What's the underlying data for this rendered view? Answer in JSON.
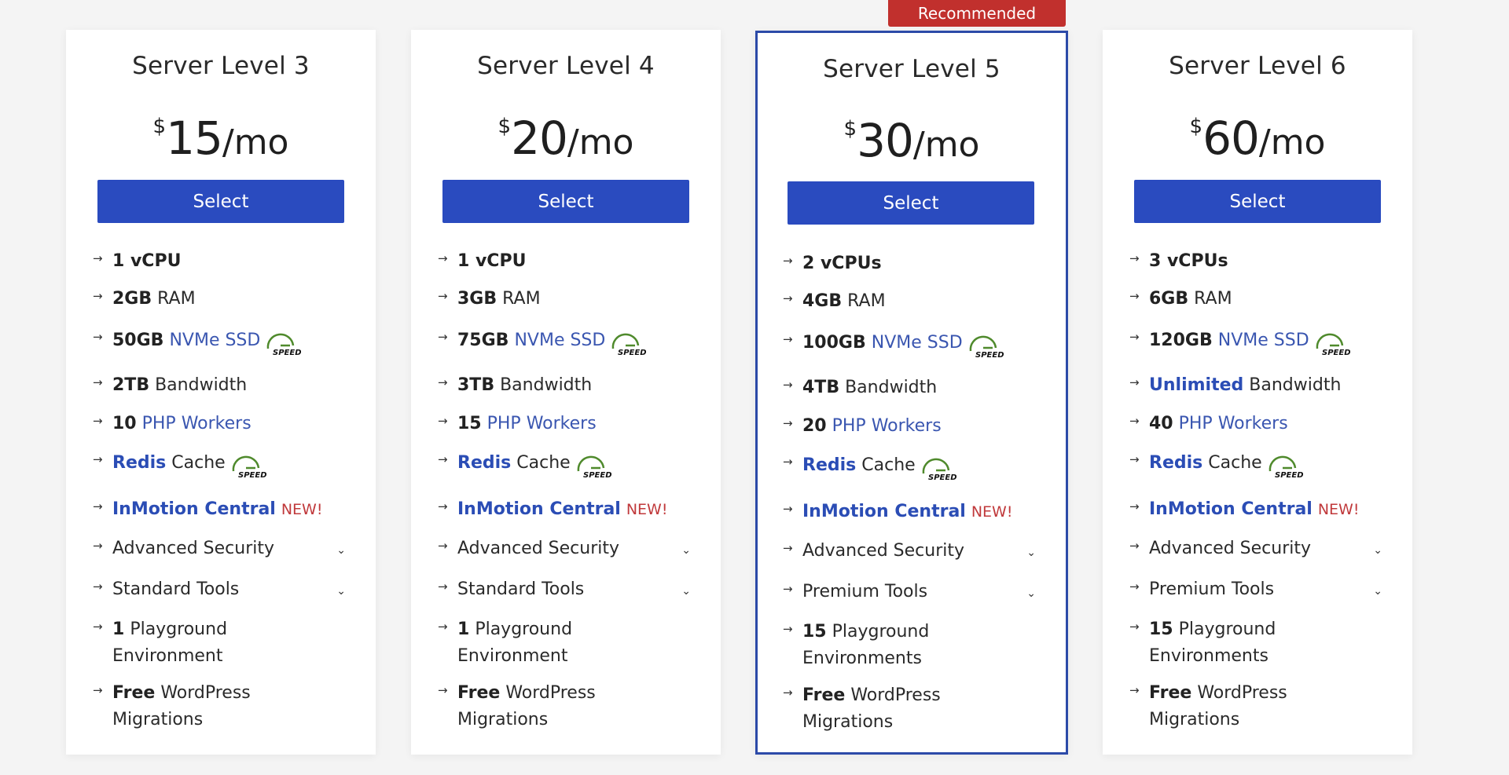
{
  "badge": "Recommended",
  "icons": {
    "arrow": "→",
    "chevron": "⌄",
    "speed_label": "SPEED"
  },
  "colors": {
    "accent_blue": "#2a4bbf",
    "badge_red": "#c1302d",
    "new_red": "#c0393b",
    "speed_green": "#4f8a2c"
  },
  "plans": [
    {
      "title": "Server Level 3",
      "price": {
        "currency": "$",
        "amount": "15",
        "period": "/mo"
      },
      "select_label": "Select",
      "features": {
        "cpu": {
          "value": "1 vCPU"
        },
        "ram": {
          "value": "2GB",
          "label": "RAM"
        },
        "ssd": {
          "value": "50GB",
          "label": "NVMe SSD"
        },
        "bandwidth": {
          "value": "2TB",
          "label": "Bandwidth"
        },
        "php": {
          "value": "10",
          "label": "PHP Workers"
        },
        "redis": {
          "value": "Redis",
          "label": "Cache"
        },
        "central": {
          "value": "InMotion Central",
          "label": "NEW!"
        },
        "security": {
          "label": "Advanced Security"
        },
        "tools": {
          "label": "Standard Tools"
        },
        "playground": {
          "value": "1",
          "label": "Playground",
          "label2": "Environment"
        },
        "migrations": {
          "value": "Free",
          "label": "WordPress",
          "label2": "Migrations"
        }
      }
    },
    {
      "title": "Server Level 4",
      "price": {
        "currency": "$",
        "amount": "20",
        "period": "/mo"
      },
      "select_label": "Select",
      "features": {
        "cpu": {
          "value": "1 vCPU"
        },
        "ram": {
          "value": "3GB",
          "label": "RAM"
        },
        "ssd": {
          "value": "75GB",
          "label": "NVMe SSD"
        },
        "bandwidth": {
          "value": "3TB",
          "label": "Bandwidth"
        },
        "php": {
          "value": "15",
          "label": "PHP Workers"
        },
        "redis": {
          "value": "Redis",
          "label": "Cache"
        },
        "central": {
          "value": "InMotion Central",
          "label": "NEW!"
        },
        "security": {
          "label": "Advanced Security"
        },
        "tools": {
          "label": "Standard Tools"
        },
        "playground": {
          "value": "1",
          "label": "Playground",
          "label2": "Environment"
        },
        "migrations": {
          "value": "Free",
          "label": "WordPress",
          "label2": "Migrations"
        }
      }
    },
    {
      "title": "Server Level 5",
      "recommended": true,
      "price": {
        "currency": "$",
        "amount": "30",
        "period": "/mo"
      },
      "select_label": "Select",
      "features": {
        "cpu": {
          "value": "2 vCPUs"
        },
        "ram": {
          "value": "4GB",
          "label": "RAM"
        },
        "ssd": {
          "value": "100GB",
          "label": "NVMe SSD"
        },
        "bandwidth": {
          "value": "4TB",
          "label": "Bandwidth"
        },
        "php": {
          "value": "20",
          "label": "PHP Workers"
        },
        "redis": {
          "value": "Redis",
          "label": "Cache"
        },
        "central": {
          "value": "InMotion Central",
          "label": "NEW!"
        },
        "security": {
          "label": "Advanced Security"
        },
        "tools": {
          "label": "Premium Tools"
        },
        "playground": {
          "value": "15",
          "label": "Playground",
          "label2": "Environments"
        },
        "migrations": {
          "value": "Free",
          "label": "WordPress",
          "label2": "Migrations"
        }
      }
    },
    {
      "title": "Server Level 6",
      "price": {
        "currency": "$",
        "amount": "60",
        "period": "/mo"
      },
      "select_label": "Select",
      "features": {
        "cpu": {
          "value": "3 vCPUs"
        },
        "ram": {
          "value": "6GB",
          "label": "RAM"
        },
        "ssd": {
          "value": "120GB",
          "label": "NVMe SSD"
        },
        "bandwidth": {
          "value": "Unlimited",
          "label": "Bandwidth",
          "value_highlight": true
        },
        "php": {
          "value": "40",
          "label": "PHP Workers"
        },
        "redis": {
          "value": "Redis",
          "label": "Cache"
        },
        "central": {
          "value": "InMotion Central",
          "label": "NEW!"
        },
        "security": {
          "label": "Advanced Security"
        },
        "tools": {
          "label": "Premium Tools"
        },
        "playground": {
          "value": "15",
          "label": "Playground",
          "label2": "Environments"
        },
        "migrations": {
          "value": "Free",
          "label": "WordPress",
          "label2": "Migrations"
        }
      }
    }
  ]
}
